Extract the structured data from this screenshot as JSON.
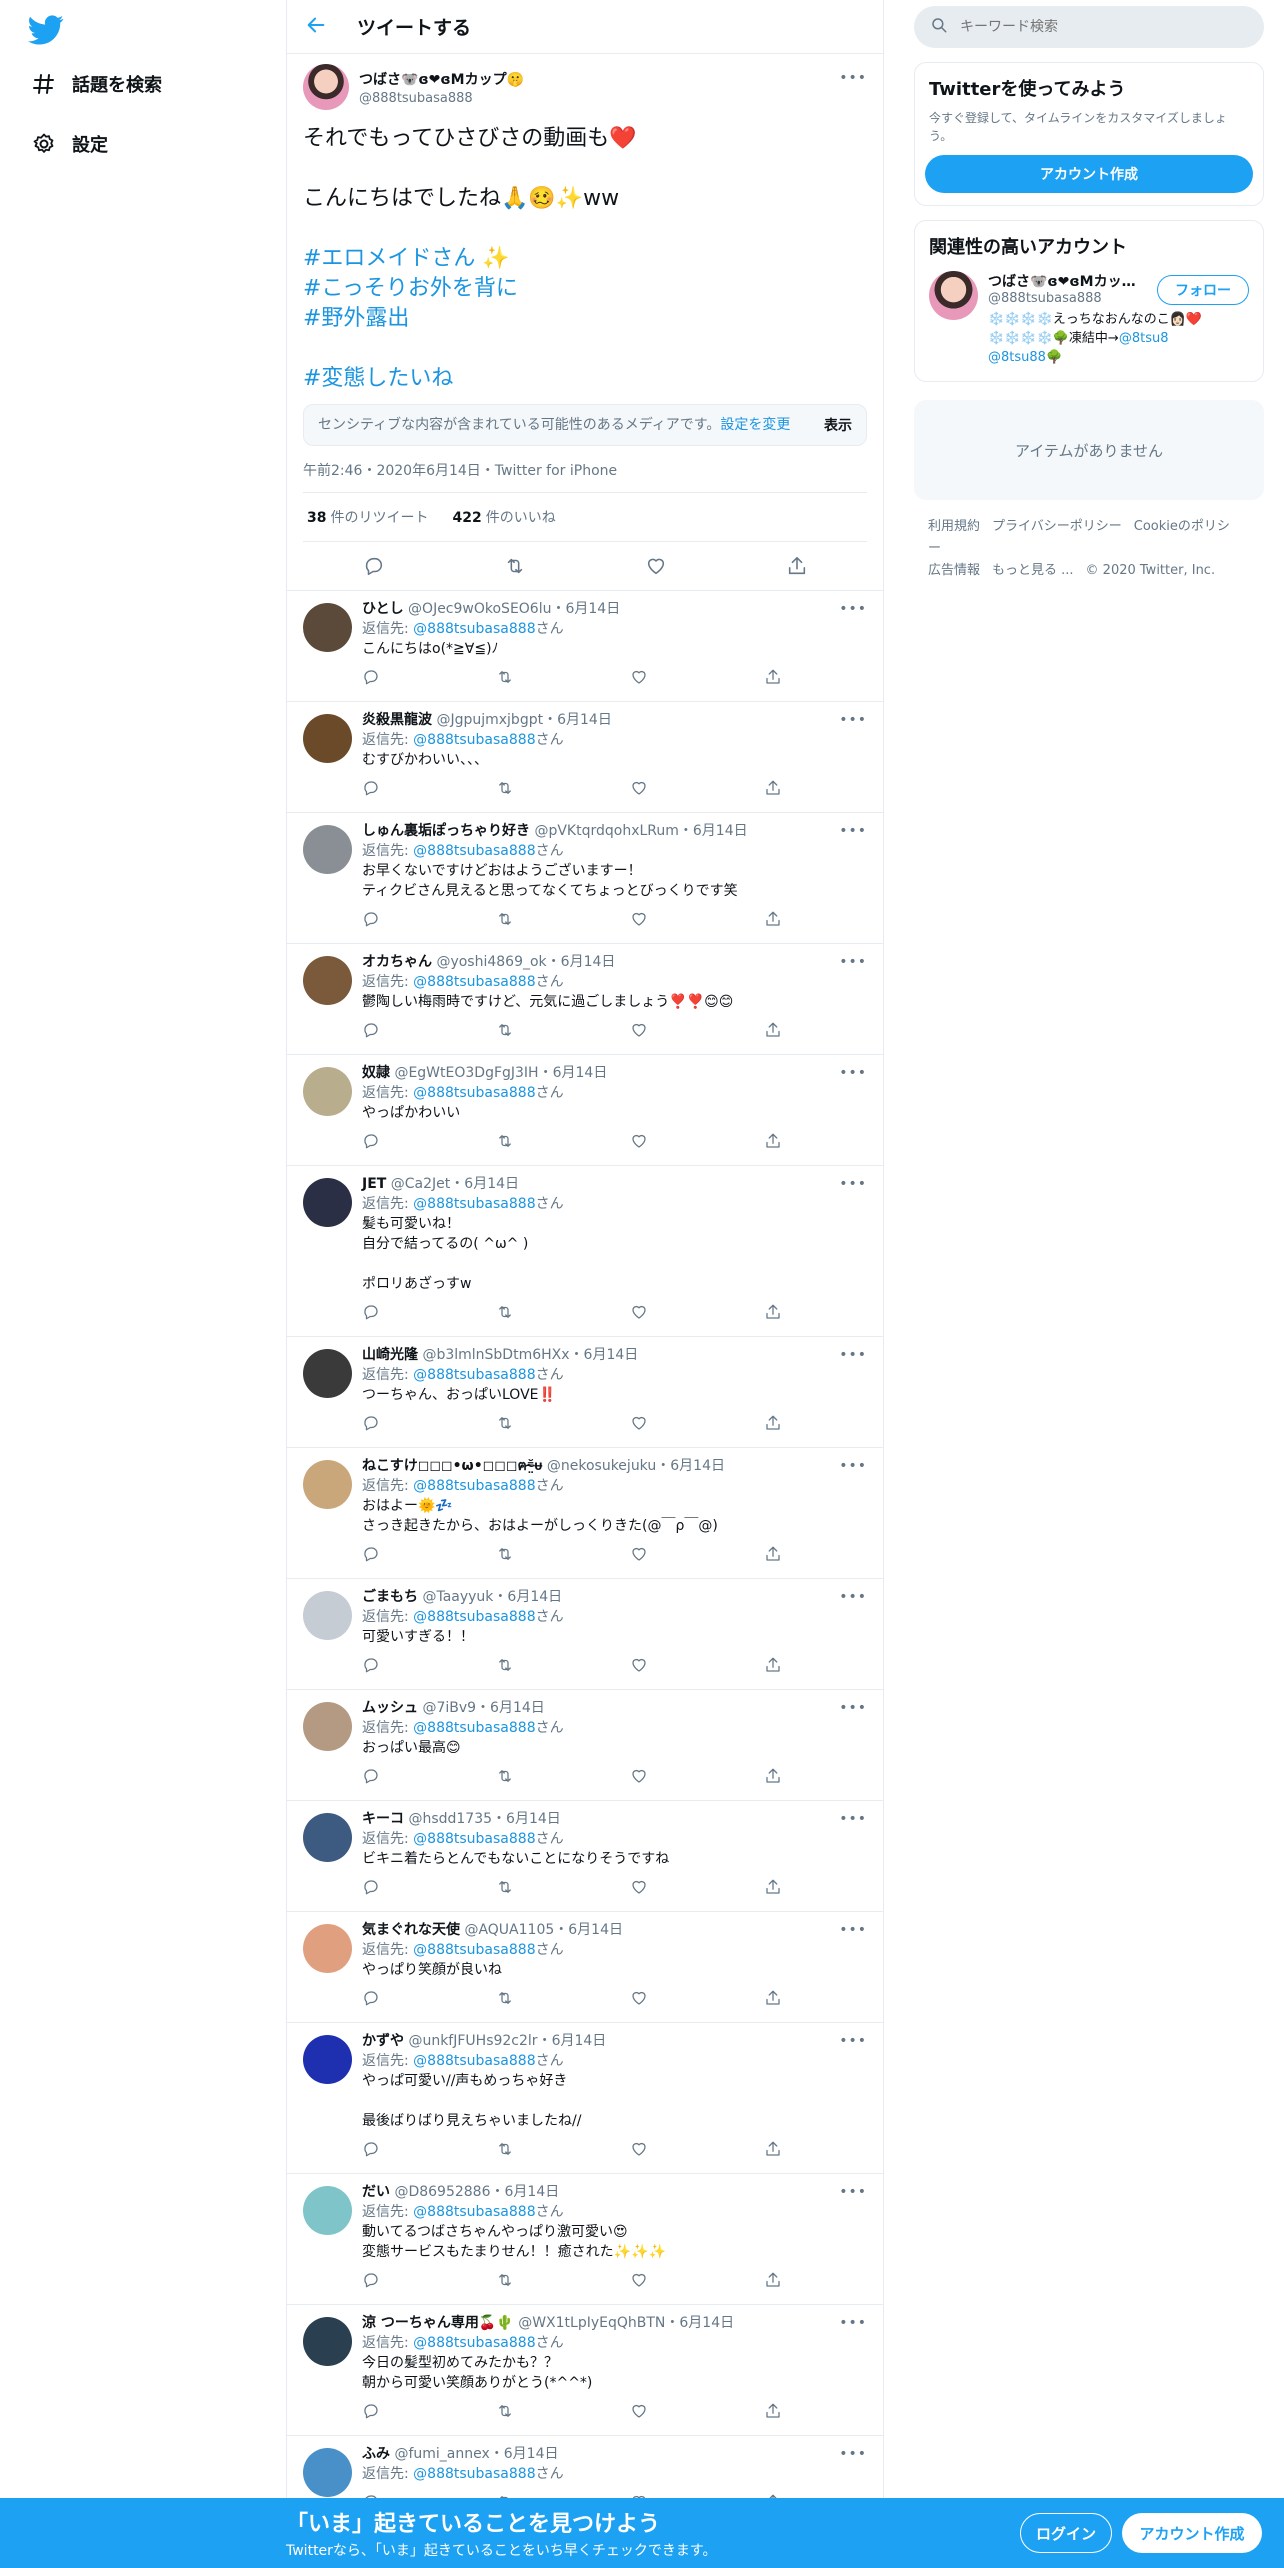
{
  "nav": {
    "items": [
      {
        "label": "話題を検索",
        "icon": "hash-icon"
      },
      {
        "label": "設定",
        "icon": "gear-icon"
      }
    ]
  },
  "header": {
    "title": "ツイートする"
  },
  "focus_tweet": {
    "name": "つばさ🐨ɞ❤ɞMカップ🤫",
    "handle": "@888tsubasa888",
    "lines": [
      "それでもってひさびさの動画も❤️",
      "",
      "こんにちはでしたね🙏🥴✨ww",
      "",
      "#エロメイドさん ✨",
      "#こっそりお外を背に",
      "#野外露出",
      "",
      "#変態したいね"
    ],
    "sensitive_text": "センシティブな内容が含まれている可能性のあるメディアです。",
    "sensitive_link": "設定を変更",
    "sensitive_show": "表示",
    "meta": "午前2:46・2020年6月14日・Twitter for iPhone",
    "retweets_count": "38",
    "retweets_label": "件のリツイート",
    "likes_count": "422",
    "likes_label": "件のいいね"
  },
  "reply_prefix": "返信先: ",
  "reply_suffix": "さん",
  "reply_mention": "@888tsubasa888",
  "replies": [
    {
      "name": "ひとし",
      "handle": "@OJec9wOkoSEO6lu",
      "date": "6月14日",
      "text": "こんにちはo(*≧∀≦)ﾉ",
      "color": "#5b4a3a"
    },
    {
      "name": "炎殺黒龍波",
      "handle": "@Jgpujmxjbgpt",
      "date": "6月14日",
      "text": "むすびかわいい、、、",
      "color": "#6b4a2a"
    },
    {
      "name": "しゅん裏垢ぽっちゃり好き",
      "handle": "@pVKtqrdqohxLRum",
      "date": "6月14日",
      "text": "お早くないですけどおはようございますー！\nティクビさん見えると思ってなくてちょっとびっくりです笑",
      "color": "#8a8f96"
    },
    {
      "name": "オカちゃん",
      "handle": "@yoshi4869_ok",
      "date": "6月14日",
      "text": "鬱陶しい梅雨時ですけど、元気に過ごしましょう❣️❣️😊😊",
      "color": "#7a5a3a"
    },
    {
      "name": "奴隷",
      "handle": "@EgWtEO3DgFgJ3IH",
      "date": "6月14日",
      "text": "やっぱかわいい",
      "color": "#b8ad8c"
    },
    {
      "name": "JET",
      "handle": "@Ca2Jet",
      "date": "6月14日",
      "text": "髪も可愛いね！\n自分で結ってるの( ^ω^ )\n\nポロリあざっすw",
      "color": "#2b2f45"
    },
    {
      "name": "山崎光隆",
      "handle": "@b3lmlnSbDtm6HXx",
      "date": "6月14日",
      "text": "つーちゃん、おっぱいLOVE‼️",
      "color": "#3a3a3a"
    },
    {
      "name": "ねこすけ◻◻◻•ω•◻◻◻ฅ⁼̴̤̆ᵾ",
      "handle": "@nekosukejuku",
      "date": "6月14日",
      "text": "おはよー🌞💤\nさっき起きたから、おはよーがしっくりきた(@￣ρ￣@)",
      "color": "#c9a77a"
    },
    {
      "name": "ごまもち",
      "handle": "@Taayyuk",
      "date": "6月14日",
      "text": "可愛いすぎる！！",
      "color": "#c5ccd3"
    },
    {
      "name": "ムッシュ",
      "handle": "@7iBv9",
      "date": "6月14日",
      "text": "おっぱい最高😊",
      "color": "#b49a82"
    },
    {
      "name": "キーコ",
      "handle": "@hsdd1735",
      "date": "6月14日",
      "text": "ビキニ着たらとんでもないことになりそうですね",
      "color": "#3d5a80"
    },
    {
      "name": "気まぐれな天使",
      "handle": "@AQUA1105",
      "date": "6月14日",
      "text": "やっぱり笑顔が良いね",
      "color": "#e0a080"
    },
    {
      "name": "かずや",
      "handle": "@unkfJFUHs92c2lr",
      "date": "6月14日",
      "text": "やっぱ可愛い//声もめっちゃ好き\n\n最後ばりばり見えちゃいましたね//",
      "color": "#1e2fb0"
    },
    {
      "name": "だい",
      "handle": "@D86952886",
      "date": "6月14日",
      "text": "動いてるつばさちゃんやっぱり激可愛い😍\n変態サービスもたまりせん！！癒された✨✨✨",
      "color": "#7fc4c9"
    },
    {
      "name": "涼 つーちゃん専用🍒🌵",
      "handle": "@WX1tLpIyEqQhBTN",
      "date": "6月14日",
      "text": "今日の髪型初めてみたかも？？\n朝から可愛い笑顔ありがとう(*^^*)",
      "color": "#2a3f4f"
    },
    {
      "name": "ふみ",
      "handle": "@fumi_annex",
      "date": "6月14日",
      "text": "",
      "color": "#4a90c8"
    }
  ],
  "sidebar": {
    "search_placeholder": "キーワード検索",
    "signup_card": {
      "title": "Twitterを使ってみよう",
      "subtitle": "今すぐ登録して、タイムラインをカスタマイズしましょう。",
      "button": "アカウント作成"
    },
    "relevant": {
      "title": "関連性の高いアカウント",
      "name": "つばさ🐨ɞ❤ɞMカッ…",
      "handle": "@888tsubasa888",
      "bio_text": "❄️❄️❄️❄️えっちなおんなのこ👩🏻❤️❄️❄️❄️❄️🌳凍結中→",
      "bio_mention1": "@8tsu8",
      "bio_mention2": "@8tsu88",
      "bio_end": "🌳",
      "follow": "フォロー"
    },
    "empty": "アイテムがありません",
    "footer": [
      "利用規約",
      "プライバシーポリシー",
      "Cookieのポリシー",
      "広告情報",
      "もっと見る ...",
      "© 2020 Twitter, Inc."
    ]
  },
  "banner": {
    "headline": "「いま」起きていることを見つけよう",
    "subline": "Twitterなら、「いま」起きていることをいち早くチェックできます。",
    "login": "ログイン",
    "signup": "アカウント作成"
  },
  "colors": {
    "accent": "#1da1f2",
    "link": "#1b95e0"
  }
}
